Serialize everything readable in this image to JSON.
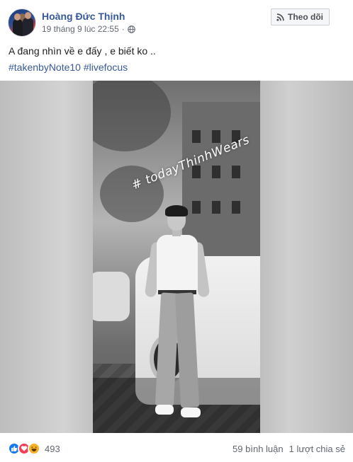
{
  "post": {
    "author": "Hoàng Đức Thịnh",
    "timestamp": "19 tháng 9 lúc 22:55",
    "separator": "·",
    "privacy_icon": "globe-icon",
    "follow_label": "Theo dõi",
    "message": "A đang nhìn về e đấy , e biết ko ..",
    "hashtags": [
      "#takenbyNote10",
      "#livefocus"
    ],
    "photo_overlay_text": "# todayThinhWears"
  },
  "footer": {
    "reaction_icons": [
      "like-icon",
      "love-icon",
      "haha-icon"
    ],
    "reaction_count": "493",
    "comments": "59 bình luận",
    "shares": "1 lượt chia sẻ"
  },
  "colors": {
    "link": "#385898",
    "like": "#1877f2",
    "love": "#f33e58",
    "haha": "#f7b125"
  }
}
